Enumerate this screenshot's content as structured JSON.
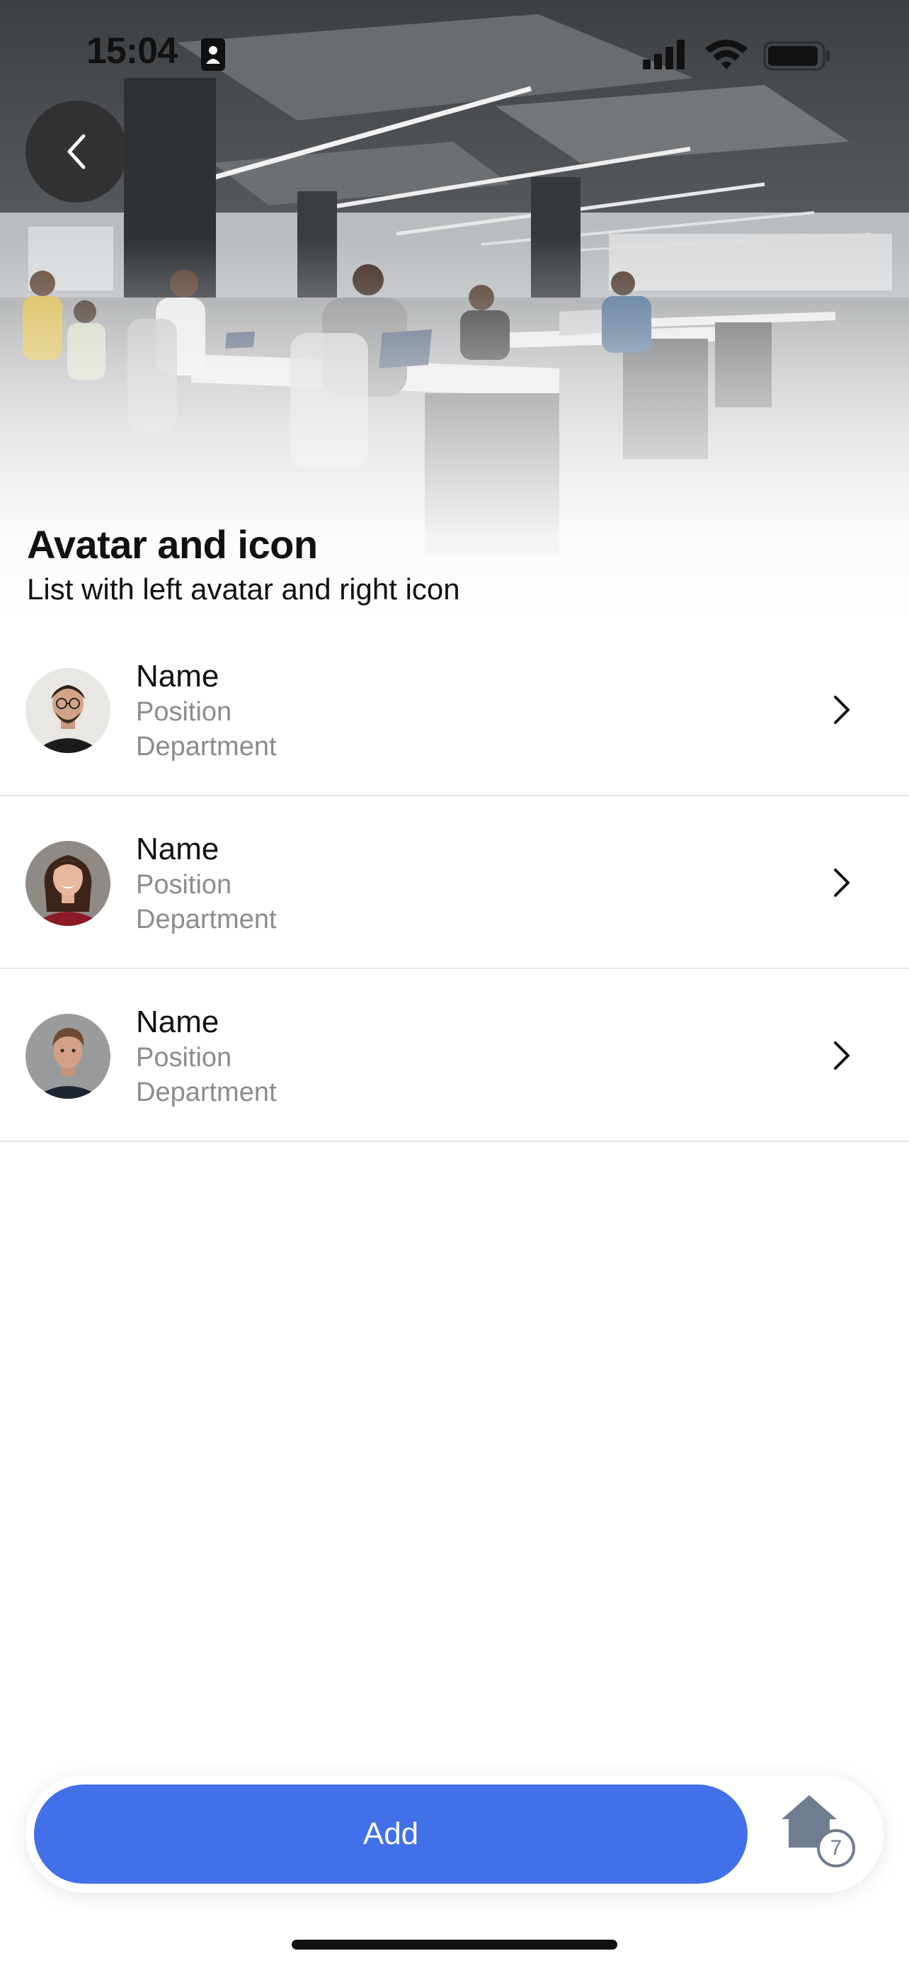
{
  "status_bar": {
    "time": "15:04",
    "icons": [
      "contact-card-icon",
      "cellular-signal-icon",
      "wifi-icon",
      "battery-icon"
    ]
  },
  "header": {
    "title": "Avatar and icon",
    "subtitle": "List with left avatar and right icon",
    "back_icon": "chevron-left-icon",
    "background": "office-photo"
  },
  "list": {
    "items": [
      {
        "name": "Name",
        "position": "Position",
        "department": "Department",
        "avatar": "man-with-glasses-avatar",
        "trailing_icon": "chevron-right-icon"
      },
      {
        "name": "Name",
        "position": "Position",
        "department": "Department",
        "avatar": "woman-smiling-avatar",
        "trailing_icon": "chevron-right-icon"
      },
      {
        "name": "Name",
        "position": "Position",
        "department": "Department",
        "avatar": "man-portrait-avatar",
        "trailing_icon": "chevron-right-icon"
      }
    ]
  },
  "bottom_bar": {
    "add_label": "Add",
    "home_icon": "home-icon",
    "home_badge": "7"
  },
  "colors": {
    "accent": "#4270e8",
    "secondary_text": "#8c8c8c",
    "divider": "#e6e6e6",
    "badge_outline": "#6f7d90"
  }
}
